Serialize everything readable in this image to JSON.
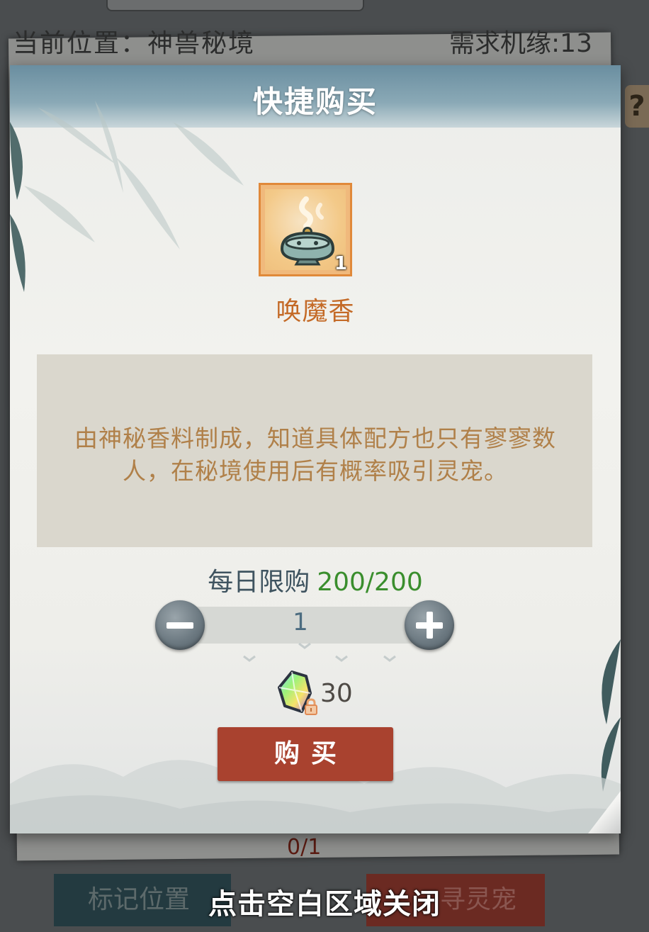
{
  "background": {
    "location_text": "当前位置：神兽秘境",
    "requirement_text": "需求机缘:13",
    "help_label": "?",
    "progress_text": "0/1",
    "mark_button_label": "标记位置",
    "seek_button_label": "寻灵宠"
  },
  "dialog": {
    "title": "快捷购买",
    "item": {
      "name": "唤魔香",
      "count": "1",
      "icon": "incense-burner-icon",
      "description": "由神秘香料制成，知道具体配方也只有寥寥数人，在秘境使用后有概率吸引灵宠。"
    },
    "daily_limit_label": "每日限购",
    "daily_limit_value": "200/200",
    "quantity": "1",
    "price": {
      "currency_icon": "spirit-gem-icon",
      "lock_icon": "lock-icon",
      "amount": "30"
    },
    "buy_label": "购买"
  },
  "close_hint": "点击空白区域关闭",
  "colors": {
    "header": "#6a8ea0",
    "item_name": "#c46a27",
    "description": "#b08049",
    "limit_value": "#3a8e2d",
    "buy_button": "#a9422f"
  }
}
